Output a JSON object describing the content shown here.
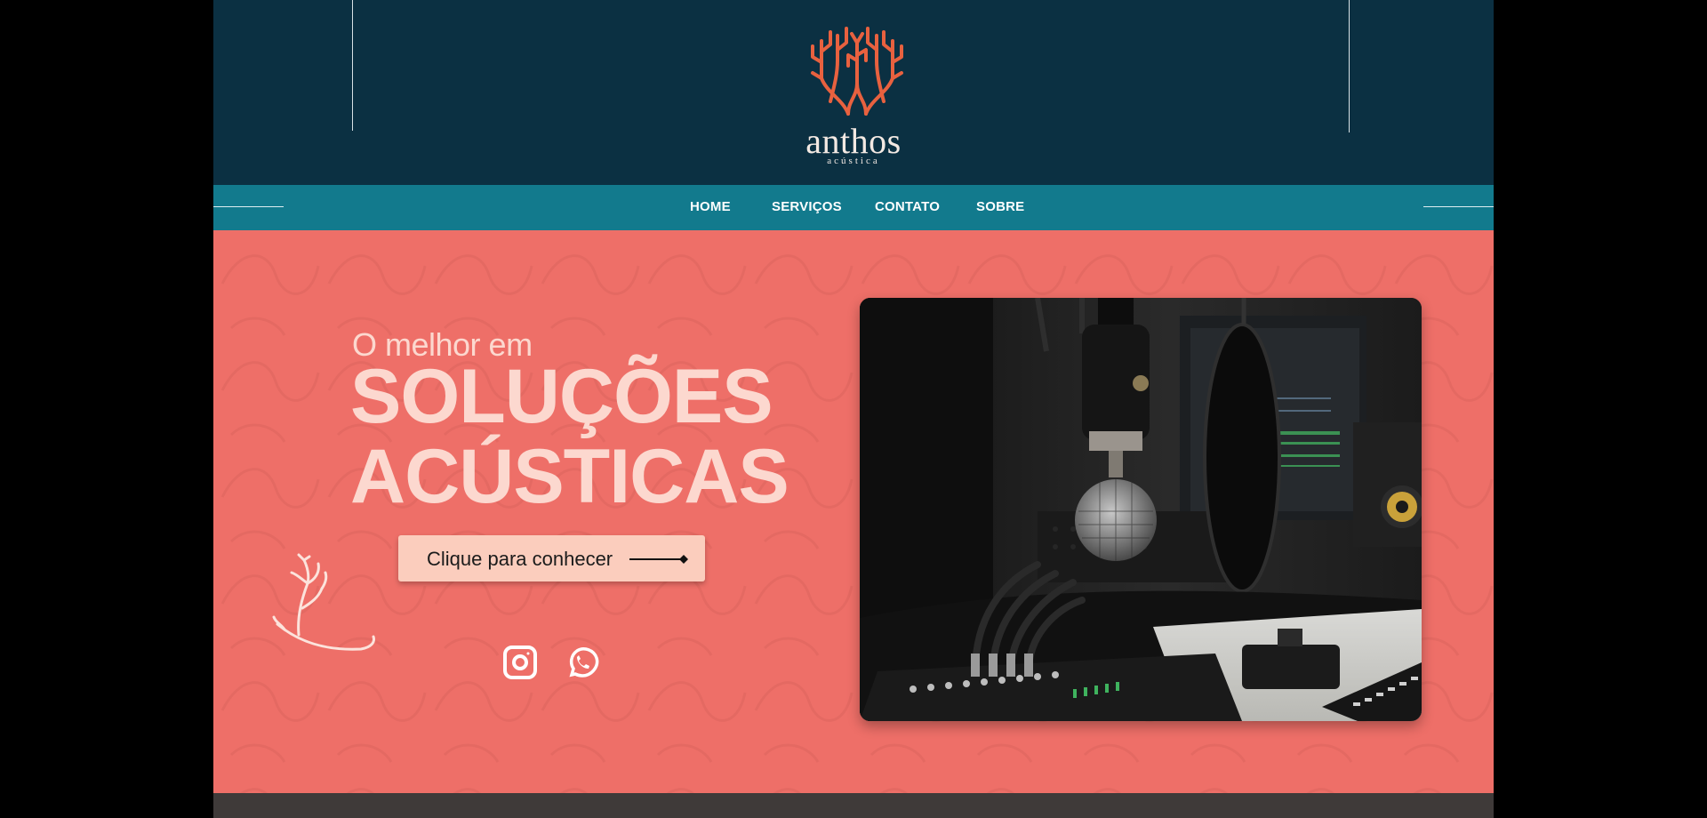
{
  "brand": {
    "name": "anthos",
    "tagline": "acústica",
    "logo_color": "#e8613f"
  },
  "nav": {
    "items": [
      {
        "label": "HOME"
      },
      {
        "label": "SERVIÇOS"
      },
      {
        "label": "CONTATO"
      },
      {
        "label": "SOBRE"
      }
    ]
  },
  "hero": {
    "eyebrow": "O melhor em",
    "headline_line1": "SOLUÇÕES",
    "headline_line2": "ACÚSTICAS",
    "cta_label": "Clique para conhecer",
    "image_alt": "Microfone em estúdio de gravação",
    "social": [
      {
        "icon": "instagram-icon"
      },
      {
        "icon": "whatsapp-icon"
      }
    ]
  },
  "colors": {
    "header_bg": "#0b3042",
    "nav_bg": "#127a8d",
    "hero_bg": "#ee6f68",
    "headline_text": "#fcd8cf",
    "cta_bg": "#fbcdbd",
    "footer_bg": "#3f3a39"
  }
}
